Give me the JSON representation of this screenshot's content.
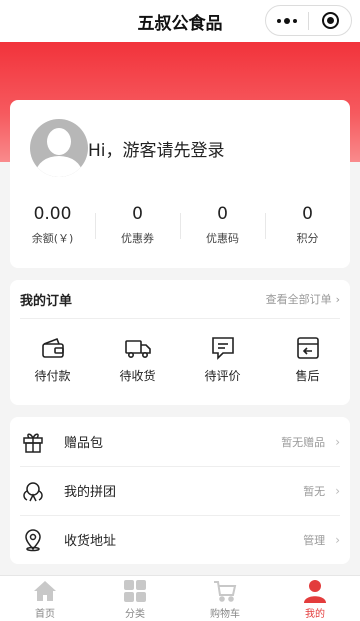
{
  "header": {
    "title": "五叔公食品"
  },
  "profile": {
    "greeting": "Hi，游客请先登录",
    "stats": [
      {
        "value": "0.00",
        "label": "余额(￥)"
      },
      {
        "value": "0",
        "label": "优惠券"
      },
      {
        "value": "0",
        "label": "优惠码"
      },
      {
        "value": "0",
        "label": "积分"
      }
    ]
  },
  "orders": {
    "title": "我的订单",
    "view_all": "查看全部订单",
    "items": [
      {
        "label": "待付款",
        "icon": "wallet-icon"
      },
      {
        "label": "待收货",
        "icon": "truck-icon"
      },
      {
        "label": "待评价",
        "icon": "comment-icon"
      },
      {
        "label": "售后",
        "icon": "return-box-icon"
      }
    ]
  },
  "menu": [
    {
      "label": "赠品包",
      "hint": "暂无赠品",
      "icon": "gift-icon"
    },
    {
      "label": "我的拼团",
      "hint": "暂无",
      "icon": "group-icon"
    },
    {
      "label": "收货地址",
      "hint": "管理",
      "icon": "location-icon"
    }
  ],
  "tabbar": [
    {
      "label": "首页",
      "icon": "home-icon"
    },
    {
      "label": "分类",
      "icon": "category-icon"
    },
    {
      "label": "购物车",
      "icon": "cart-icon"
    },
    {
      "label": "我的",
      "icon": "user-icon",
      "active": true
    }
  ],
  "colors": {
    "accent": "#e33c3c",
    "inactive": "#c8c8c8"
  }
}
